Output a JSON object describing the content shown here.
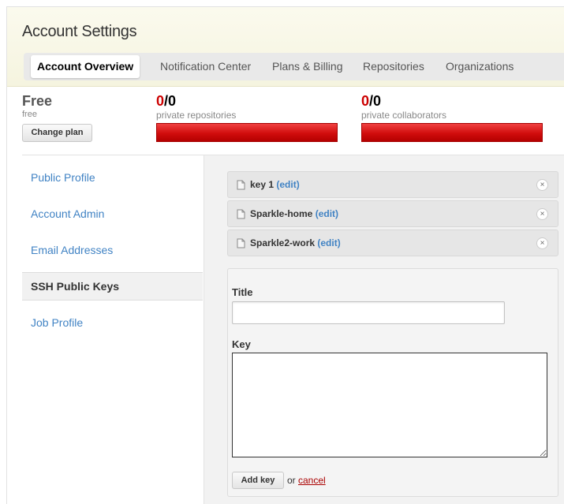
{
  "header": {
    "title": "Account Settings",
    "tabs": [
      {
        "label": "Account Overview",
        "active": true
      },
      {
        "label": "Notification Center",
        "active": false
      },
      {
        "label": "Plans & Billing",
        "active": false
      },
      {
        "label": "Repositories",
        "active": false
      },
      {
        "label": "Organizations",
        "active": false
      }
    ]
  },
  "plan": {
    "name": "Free",
    "sub": "free",
    "change_label": "Change plan"
  },
  "stats": {
    "repos": {
      "used": "0",
      "total": "/0",
      "label": "private repositories"
    },
    "collaborators": {
      "used": "0",
      "total": "/0",
      "label": "private collaborators"
    }
  },
  "sidebar": {
    "items": [
      {
        "label": "Public Profile",
        "active": false
      },
      {
        "label": "Account Admin",
        "active": false
      },
      {
        "label": "Email Addresses",
        "active": false
      },
      {
        "label": "SSH Public Keys",
        "active": true
      },
      {
        "label": "Job Profile",
        "active": false
      }
    ]
  },
  "keys": [
    {
      "title": "key 1",
      "edit": "(edit)",
      "remove": "×"
    },
    {
      "title": "Sparkle-home",
      "edit": "(edit)",
      "remove": "×"
    },
    {
      "title": "Sparkle2-work",
      "edit": "(edit)",
      "remove": "×"
    }
  ],
  "form": {
    "title_label": "Title",
    "title_value": "",
    "key_label": "Key",
    "key_value": "",
    "add_label": "Add key",
    "or_text": "or",
    "cancel_label": "cancel"
  },
  "colors": {
    "link": "#4183c4",
    "usage_red": "#cc0000",
    "cancel_red": "#aa0000"
  }
}
